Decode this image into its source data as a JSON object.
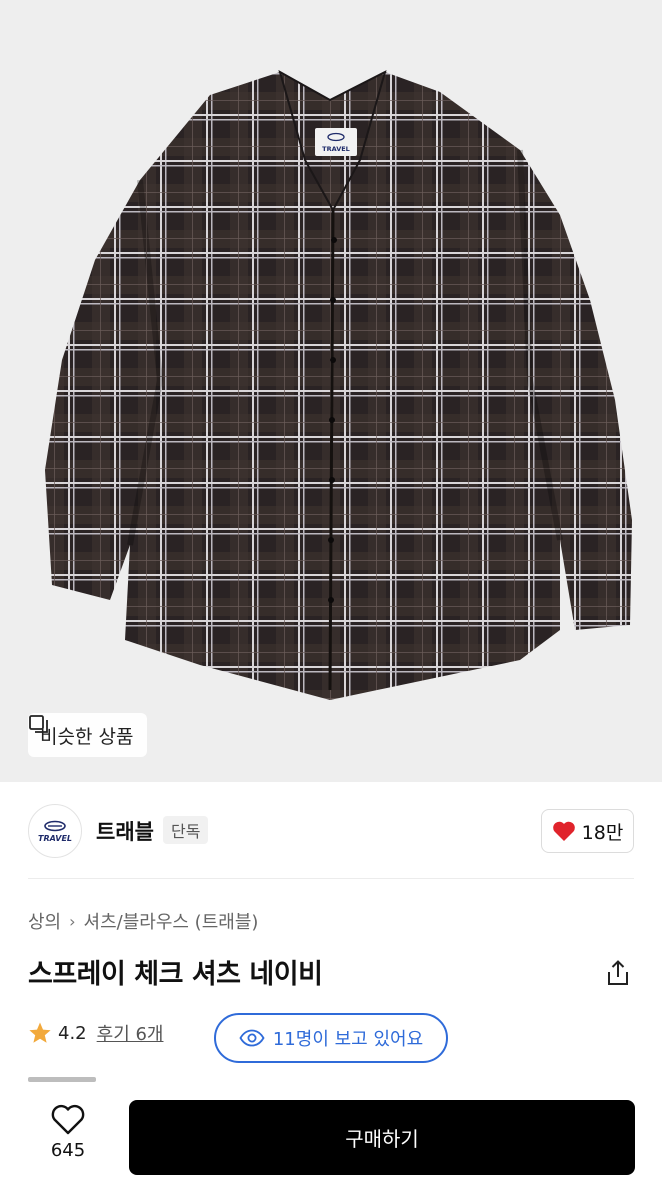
{
  "hero": {
    "similar_label": "비슷한 상품",
    "tag_brand": "TRAVEL"
  },
  "brand": {
    "logo_text": "TRAVEL",
    "name": "트래블",
    "badge": "단독",
    "likes": "18만"
  },
  "breadcrumb": {
    "category": "상의",
    "subcategory": "셔츠/블라우스 (트래블)"
  },
  "product": {
    "title": "스프레이 체크 셔츠 네이비"
  },
  "rating": {
    "score": "4.2",
    "reviews": "후기 6개"
  },
  "viewers": {
    "label": "11명이 보고 있어요"
  },
  "bottom": {
    "wish_count": "645",
    "buy_label": "구매하기"
  },
  "colors": {
    "accent_blue": "#2f6bd9",
    "heart_red": "#e0232b",
    "star_orange": "#f2a93b"
  }
}
